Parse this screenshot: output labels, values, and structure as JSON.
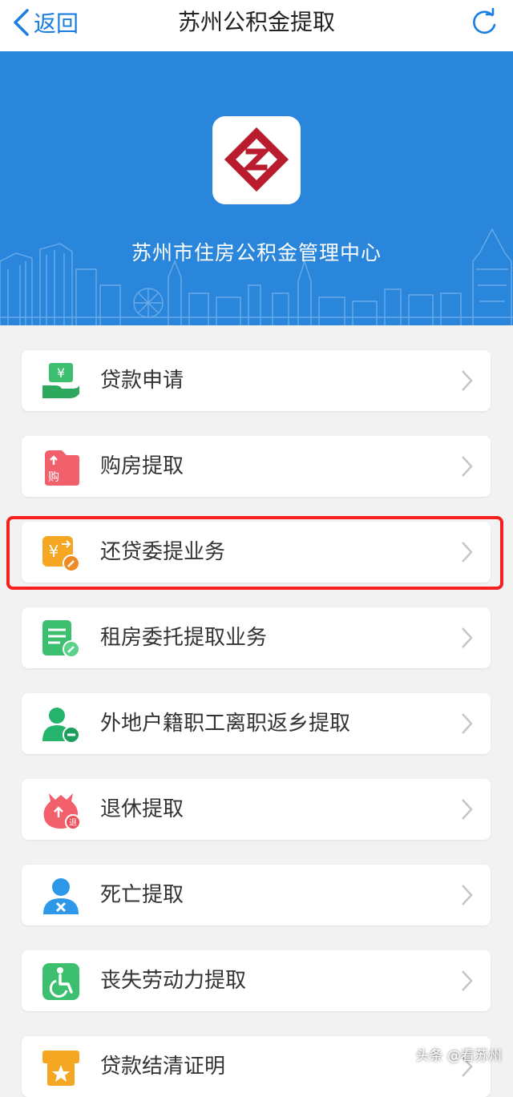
{
  "navbar": {
    "back_label": "返回",
    "title": "苏州公积金提取"
  },
  "banner": {
    "org_name": "苏州市住房公积金管理中心"
  },
  "menu": {
    "items": [
      {
        "label": "贷款申请",
        "icon": "loan-hand-icon",
        "color": "#3cbf6f"
      },
      {
        "label": "购房提取",
        "icon": "purchase-house-icon",
        "color": "#f2606b"
      },
      {
        "label": "还贷委提业务",
        "icon": "repayment-yen-icon",
        "color": "#f5a623"
      },
      {
        "label": "租房委托提取业务",
        "icon": "rent-document-icon",
        "color": "#3cbf6f"
      },
      {
        "label": "外地户籍职工离职返乡提取",
        "icon": "user-minus-icon",
        "color": "#24b46c"
      },
      {
        "label": "退休提取",
        "icon": "retirement-pouch-icon",
        "color": "#f2606b"
      },
      {
        "label": "死亡提取",
        "icon": "user-x-icon",
        "color": "#2d98e8"
      },
      {
        "label": "丧失劳动力提取",
        "icon": "wheelchair-icon",
        "color": "#3cbf6f"
      },
      {
        "label": "贷款结清证明",
        "icon": "certificate-icon",
        "color": "#f5a623"
      }
    ]
  },
  "watermark": "头条 @看苏州",
  "colors": {
    "accent": "#1a7de0",
    "banner": "#2a86db",
    "highlight": "#f42020",
    "logo": "#b81c2e"
  }
}
